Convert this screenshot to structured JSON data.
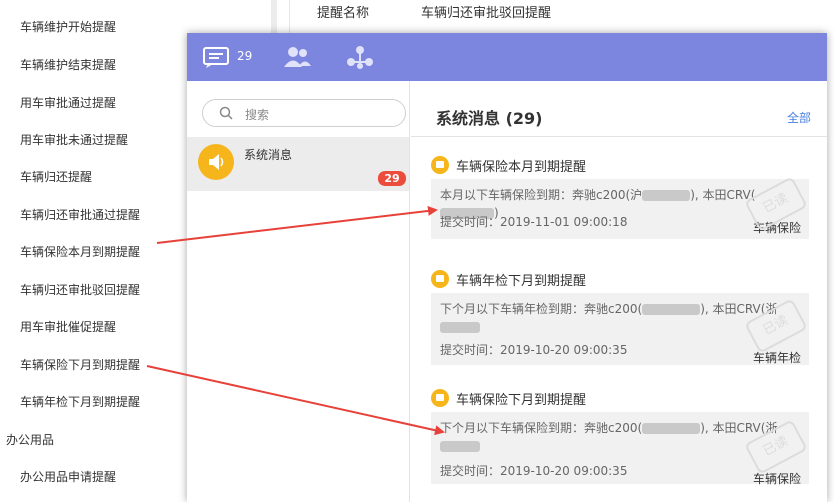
{
  "left_menu": {
    "items": [
      "车辆维护开始提醒",
      "车辆维护结束提醒",
      "用车审批通过提醒",
      "用车审批未通过提醒",
      "车辆归还提醒",
      "车辆归还审批通过提醒",
      "车辆保险本月到期提醒",
      "车辆归还审批驳回提醒",
      "用车审批催促提醒",
      "车辆保险下月到期提醒",
      "车辆年检下月到期提醒"
    ],
    "group": "办公用品",
    "sub_item": "办公用品申请提醒"
  },
  "bg_header": {
    "key": "提醒名称",
    "value": "车辆归还审批驳回提醒"
  },
  "topbar": {
    "count": "29"
  },
  "sidebar": {
    "search_placeholder": "搜索",
    "conversation": {
      "title": "系统消息",
      "badge": "29"
    }
  },
  "main": {
    "title": "系统消息 (29)",
    "all_link": "全部",
    "messages": [
      {
        "title": "车辆保险本月到期提醒",
        "text_a": "本月以下车辆保险到期：奔驰c200(沪",
        "text_b": "), 本田CRV(",
        "text_c": ")",
        "time": "提交时间：2019-11-01 09:00:18",
        "tag": "车辆保险",
        "stamp": "已读"
      },
      {
        "title": "车辆年检下月到期提醒",
        "text_a": "下个月以下车辆年检到期：奔驰c200(",
        "text_b": "), 本田CRV(浙",
        "text_c": "",
        "time": "提交时间：2019-10-20 09:00:35",
        "tag": "车辆年检",
        "stamp": "已读"
      },
      {
        "title": "车辆保险下月到期提醒",
        "text_a": "下个月以下车辆保险到期：奔驰c200(",
        "text_b": "), 本田CRV(浙",
        "text_c": "",
        "time": "提交时间：2019-10-20 09:00:35",
        "tag": "车辆保险",
        "stamp": "已读"
      }
    ]
  },
  "colors": {
    "topbar": "#7d86df",
    "badge": "#ec4c3c",
    "accent": "#f5b51b",
    "arrow": "#e8413a",
    "link": "#4a7fe0"
  }
}
